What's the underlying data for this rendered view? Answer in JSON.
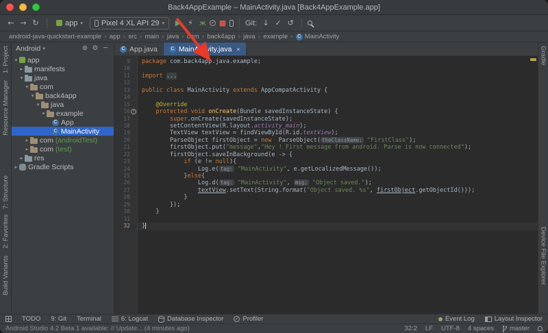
{
  "colors": {
    "selection_blue": "#2f65ca",
    "active_tab_blue": "#3a5a84",
    "run_green": "#59a869",
    "stop_red": "#c75450",
    "annotation_red": "#e8392b",
    "editor_background": "#2b2b2b",
    "panel_background": "#3c3f41"
  },
  "titlebar": {
    "title": "Back4AppExample – MainActivity.java [Back4AppExample.app]"
  },
  "toolbar": {
    "nav_icons": [
      {
        "name": "navigate-back-icon",
        "glyph": "←"
      },
      {
        "name": "navigate-forward-icon",
        "glyph": "→"
      },
      {
        "name": "sync-project-icon",
        "glyph": "↻"
      }
    ],
    "run_config": "app",
    "device": "Pixel 4 XL API 29",
    "action_icons": [
      {
        "name": "run-icon",
        "glyph": "▶",
        "color": "#59a869"
      },
      {
        "name": "apply-changes-icon",
        "glyph": "⚡"
      },
      {
        "name": "debug-icon",
        "glyph": "ж",
        "color": "#7fa35c"
      },
      {
        "name": "profiler-icon",
        "shape": "gauge"
      },
      {
        "name": "stop-icon",
        "glyph": "■",
        "color": "#c75450"
      },
      {
        "name": "device-manager-icon",
        "shape": "phone"
      }
    ],
    "git_label": "Git:",
    "git_icons": [
      {
        "name": "update-project-icon",
        "glyph": "↓"
      },
      {
        "name": "commit-icon",
        "glyph": "✓"
      },
      {
        "name": "rollback-icon",
        "glyph": "↺"
      }
    ]
  },
  "breadcrumbs": {
    "items": [
      "android-java-quickstart-example",
      "app",
      "src",
      "main",
      "java",
      "com",
      "back4app",
      "java",
      "example",
      "MainActivity"
    ]
  },
  "stripes": {
    "left": [
      {
        "name": "stripe-project",
        "label": "1: Project"
      },
      {
        "name": "stripe-resource-manager",
        "label": "Resource Manager"
      },
      {
        "name": "stripe-structure",
        "label": "7: Structure"
      },
      {
        "name": "stripe-favorites",
        "label": "2: Favorites"
      },
      {
        "name": "stripe-build-variants",
        "label": "Build Variants"
      }
    ],
    "right": [
      {
        "name": "stripe-gradle",
        "label": "Gradle"
      },
      {
        "name": "stripe-device-file-explorer",
        "label": "Device File Explorer"
      }
    ]
  },
  "project": {
    "view": "Android",
    "tree": [
      {
        "label": "app",
        "depth": 0,
        "state": "open",
        "icon": "android"
      },
      {
        "label": "manifests",
        "depth": 1,
        "state": "closed",
        "icon": "folder"
      },
      {
        "label": "java",
        "depth": 1,
        "state": "open",
        "icon": "folder"
      },
      {
        "label": "com",
        "depth": 2,
        "state": "open",
        "icon": "package"
      },
      {
        "label": "back4app",
        "depth": 3,
        "state": "open",
        "icon": "package"
      },
      {
        "label": "java",
        "depth": 4,
        "state": "open",
        "icon": "package"
      },
      {
        "label": "example",
        "depth": 5,
        "state": "open",
        "icon": "package"
      },
      {
        "label": "App",
        "depth": 6,
        "icon": "class"
      },
      {
        "label": "MainActivity",
        "depth": 6,
        "icon": "class",
        "selected": true
      },
      {
        "label": "com",
        "suffix": "(androidTest)",
        "depth": 2,
        "state": "closed",
        "icon": "package"
      },
      {
        "label": "com",
        "suffix": "(test)",
        "depth": 2,
        "state": "closed",
        "icon": "package"
      },
      {
        "label": "res",
        "depth": 1,
        "state": "closed",
        "icon": "folder"
      },
      {
        "label": "Gradle Scripts",
        "depth": 0,
        "state": "closed",
        "icon": "gradle"
      }
    ]
  },
  "editor": {
    "tabs": [
      {
        "label": "App.java",
        "active": false
      },
      {
        "label": "MainActivity.java",
        "active": true
      }
    ],
    "lines": [
      {
        "n": 9,
        "seg": [
          [
            "k",
            "package"
          ],
          [
            "p",
            " com.back4app.java.example;"
          ]
        ]
      },
      {
        "n": 10,
        "seg": []
      },
      {
        "n": 11,
        "seg": [
          [
            "k",
            "import"
          ],
          [
            "p",
            " "
          ],
          [
            "fold",
            "..."
          ]
        ]
      },
      {
        "n": 12,
        "seg": []
      },
      {
        "n": 13,
        "seg": [
          [
            "k",
            "public class"
          ],
          [
            "p",
            " MainActivity "
          ],
          [
            "k",
            "extends"
          ],
          [
            "p",
            " AppCompatActivity {"
          ]
        ]
      },
      {
        "n": 14,
        "seg": []
      },
      {
        "n": 15,
        "seg": [
          [
            "p",
            "    "
          ],
          [
            "a",
            "@Override"
          ]
        ]
      },
      {
        "n": 16,
        "seg": [
          [
            "p",
            "    "
          ],
          [
            "k",
            "protected void"
          ],
          [
            "m",
            " onCreate"
          ],
          [
            "p",
            "(Bundle savedInstanceState) {"
          ]
        ],
        "gutter_icon": "override"
      },
      {
        "n": 17,
        "seg": [
          [
            "p",
            "        "
          ],
          [
            "k",
            "super"
          ],
          [
            "p",
            ".onCreate(savedInstanceState);"
          ]
        ]
      },
      {
        "n": 18,
        "seg": [
          [
            "p",
            "        setContentView(R.layout."
          ],
          [
            "f",
            "activity_main"
          ],
          [
            "p",
            ");"
          ]
        ]
      },
      {
        "n": 19,
        "seg": [
          [
            "p",
            "        TextView textView = findViewById(R.id."
          ],
          [
            "f",
            "textView"
          ],
          [
            "p",
            ");"
          ]
        ]
      },
      {
        "n": 20,
        "seg": [
          [
            "p",
            "        ParseObject firstObject = "
          ],
          [
            "k",
            "new"
          ],
          [
            "p",
            "  ParseObject("
          ],
          [
            "h",
            "theClassName:"
          ],
          [
            "p",
            " "
          ],
          [
            "s",
            "\"FirstClass\""
          ],
          [
            "p",
            ");"
          ]
        ]
      },
      {
        "n": 21,
        "seg": [
          [
            "p",
            "        firstObject.put("
          ],
          [
            "s",
            "\"message\""
          ],
          [
            "p",
            ","
          ],
          [
            "s",
            "\"Hey ! First message from android. Parse is now connected\""
          ],
          [
            "p",
            ");"
          ]
        ]
      },
      {
        "n": 22,
        "seg": [
          [
            "p",
            "        firstObject.saveInBackground(e -> {"
          ]
        ]
      },
      {
        "n": 23,
        "seg": [
          [
            "p",
            "            "
          ],
          [
            "k",
            "if"
          ],
          [
            "p",
            " (e != "
          ],
          [
            "k",
            "null"
          ],
          [
            "p",
            "){"
          ]
        ]
      },
      {
        "n": 24,
        "seg": [
          [
            "p",
            "                Log.e("
          ],
          [
            "h",
            "tag:"
          ],
          [
            "p",
            " "
          ],
          [
            "s",
            "\"MainActivity\""
          ],
          [
            "p",
            ", e.getLocalizedMessage());"
          ]
        ]
      },
      {
        "n": 25,
        "seg": [
          [
            "p",
            "            }"
          ],
          [
            "k",
            "else"
          ],
          [
            "p",
            "{"
          ]
        ]
      },
      {
        "n": 26,
        "seg": [
          [
            "p",
            "                Log.d("
          ],
          [
            "h",
            "tag:"
          ],
          [
            "p",
            " "
          ],
          [
            "s",
            "\"MainActivity\""
          ],
          [
            "p",
            ", "
          ],
          [
            "h",
            "msg:"
          ],
          [
            "p",
            " "
          ],
          [
            "s",
            "\"Object saved.\""
          ],
          [
            "p",
            ");"
          ]
        ]
      },
      {
        "n": 27,
        "seg": [
          [
            "p",
            "                "
          ],
          [
            "u",
            "textView"
          ],
          [
            "p",
            ".setText(String."
          ],
          [
            "st",
            "format"
          ],
          [
            "p",
            "("
          ],
          [
            "s",
            "\"Object saved. %s\""
          ],
          [
            "p",
            ", "
          ],
          [
            "u",
            "firstObject"
          ],
          [
            "p",
            ".getObjectId()));"
          ]
        ]
      },
      {
        "n": 28,
        "seg": [
          [
            "p",
            "            }"
          ]
        ]
      },
      {
        "n": 29,
        "seg": [
          [
            "p",
            "        });"
          ]
        ]
      },
      {
        "n": 30,
        "seg": [
          [
            "p",
            "    }"
          ]
        ]
      },
      {
        "n": 31,
        "seg": []
      },
      {
        "n": 32,
        "seg": [
          [
            "p",
            "}"
          ]
        ],
        "current": true
      }
    ]
  },
  "bottom_bar": {
    "left": [
      {
        "name": "tool-window-switcher",
        "icon": "grid"
      },
      {
        "name": "todo",
        "label": "TODO"
      },
      {
        "name": "git",
        "label": "9: Git"
      },
      {
        "name": "terminal",
        "label": "Terminal"
      },
      {
        "name": "logcat",
        "icon": "list",
        "label": "6: Logcat"
      },
      {
        "name": "database-inspector",
        "icon": "db",
        "label": "Database Inspector"
      },
      {
        "name": "profiler",
        "icon": "gauge",
        "label": "Profiler"
      }
    ],
    "right": [
      {
        "name": "event-log",
        "icon": "dot",
        "label": "Event Log"
      },
      {
        "name": "layout-inspector",
        "icon": "layout",
        "label": "Layout Inspector"
      }
    ]
  },
  "status_bar": {
    "message": "Android Studio 4.2 Beta 1 available: // Update... (4 minutes ago)",
    "caret": "32:2",
    "line_ending": "LF",
    "encoding": "UTF-8",
    "indent": "4 spaces",
    "branch": "master"
  }
}
